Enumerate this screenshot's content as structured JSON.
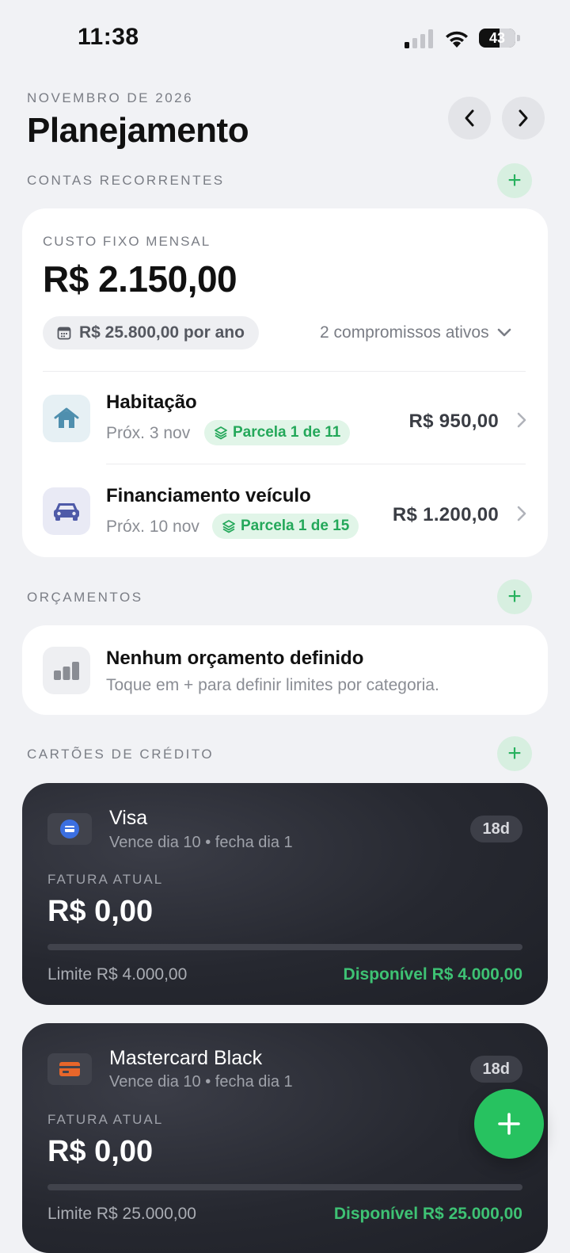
{
  "status_bar": {
    "time": "11:38",
    "battery": "43"
  },
  "header": {
    "period": "NOVEMBRO DE 2026",
    "title": "Planejamento"
  },
  "recurring": {
    "section_title": "CONTAS RECORRENTES",
    "fixed_label": "CUSTO FIXO MENSAL",
    "fixed_amount": "R$ 2.150,00",
    "per_year": "R$ 25.800,00 por ano",
    "active_commitments": "2 compromissos ativos",
    "items": [
      {
        "title": "Habitação",
        "next": "Próx. 3 nov",
        "installment": "Parcela 1 de 11",
        "amount": "R$ 950,00",
        "icon": "house-icon",
        "icon_color": "#4f8fae"
      },
      {
        "title": "Financiamento veículo",
        "next": "Próx. 10 nov",
        "installment": "Parcela 1 de 15",
        "amount": "R$ 1.200,00",
        "icon": "car-icon",
        "icon_color": "#4e5aa8"
      }
    ]
  },
  "budgets": {
    "section_title": "ORÇAMENTOS",
    "empty_title": "Nenhum orçamento definido",
    "empty_hint": "Toque em + para definir limites por categoria."
  },
  "credit_cards": {
    "section_title": "CARTÕES DE CRÉDITO",
    "cards": [
      {
        "name": "Visa",
        "schedule": "Vence dia 10 • fecha dia 1",
        "days": "18d",
        "invoice_label": "FATURA ATUAL",
        "invoice": "R$ 0,00",
        "limit": "Limite R$ 4.000,00",
        "available": "Disponível R$ 4.000,00",
        "usage": 0,
        "logo_color": "#3b6fe0"
      },
      {
        "name": "Mastercard Black",
        "schedule": "Vence dia 10 • fecha dia 1",
        "days": "18d",
        "invoice_label": "FATURA ATUAL",
        "invoice": "R$ 0,00",
        "limit": "Limite R$ 25.000,00",
        "available": "Disponível R$ 25.000,00",
        "usage": 0,
        "logo_color": "#e8662a"
      }
    ]
  },
  "colors": {
    "accent": "#27c260",
    "badge_text": "#24a85a",
    "background": "#f1f2f5"
  }
}
